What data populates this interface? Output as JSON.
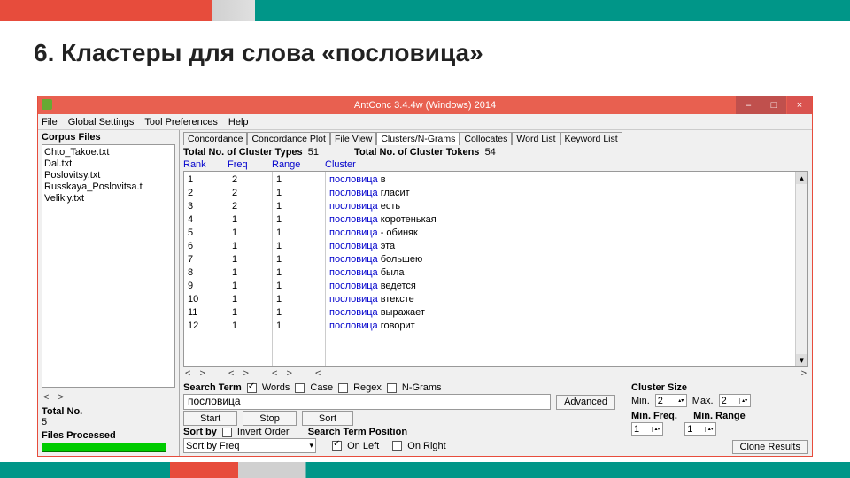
{
  "slide": {
    "title": "6. Кластеры для слова «пословица»"
  },
  "window": {
    "title": "AntConc 3.4.4w (Windows) 2014"
  },
  "winbtns": {
    "min": "–",
    "max": "□",
    "close": "×"
  },
  "menu": {
    "file": "File",
    "global": "Global Settings",
    "tool": "Tool Preferences",
    "help": "Help"
  },
  "left": {
    "corpus_label": "Corpus Files",
    "files": [
      "Chto_Takoe.txt",
      "Dal.txt",
      "Poslovitsy.txt",
      "Russkaya_Poslovitsa.t",
      "Velikiy.txt"
    ],
    "totalno_label": "Total No.",
    "totalno_value": "5",
    "filesproc_label": "Files Processed"
  },
  "tabs": [
    "Concordance",
    "Concordance Plot",
    "File View",
    "Clusters/N-Grams",
    "Collocates",
    "Word List",
    "Keyword List"
  ],
  "totals": {
    "types_label": "Total No. of Cluster Types",
    "types_value": "51",
    "tokens_label": "Total No. of Cluster Tokens",
    "tokens_value": "54"
  },
  "colheads": {
    "rank": "Rank",
    "freq": "Freq",
    "range": "Range",
    "cluster": "Cluster"
  },
  "rows": [
    {
      "rank": "1",
      "freq": "2",
      "range": "1",
      "kw": "пословица",
      "rest": " в"
    },
    {
      "rank": "2",
      "freq": "2",
      "range": "1",
      "kw": "пословица",
      "rest": " гласит"
    },
    {
      "rank": "3",
      "freq": "2",
      "range": "1",
      "kw": "пословица",
      "rest": " есть"
    },
    {
      "rank": "4",
      "freq": "1",
      "range": "1",
      "kw": "пословица",
      "rest": "   коротенькая"
    },
    {
      "rank": "5",
      "freq": "1",
      "range": "1",
      "kw": "пословица",
      "rest": " - обиняк"
    },
    {
      "rank": "6",
      "freq": "1",
      "range": "1",
      "kw": "пословица",
      "rest": "   эта"
    },
    {
      "rank": "7",
      "freq": "1",
      "range": "1",
      "kw": "пословица",
      "rest": " большею"
    },
    {
      "rank": "8",
      "freq": "1",
      "range": "1",
      "kw": "пословица",
      "rest": " была"
    },
    {
      "rank": "9",
      "freq": "1",
      "range": "1",
      "kw": "пословица",
      "rest": " ведется"
    },
    {
      "rank": "10",
      "freq": "1",
      "range": "1",
      "kw": "пословица",
      "rest": " втексте"
    },
    {
      "rank": "11",
      "freq": "1",
      "range": "1",
      "kw": "пословица",
      "rest": " выражает"
    },
    {
      "rank": "12",
      "freq": "1",
      "range": "1",
      "kw": "пословица",
      "rest": " говорит"
    }
  ],
  "search": {
    "label": "Search Term",
    "words": "Words",
    "case": "Case",
    "regex": "Regex",
    "ngrams": "N-Grams",
    "value": "пословица",
    "advanced": "Advanced",
    "start": "Start",
    "stop": "Stop",
    "sort": "Sort",
    "sortby": "Sort by",
    "invert": "Invert Order",
    "sortval": "Sort by Freq",
    "pos_label": "Search Term Position",
    "onleft": "On Left",
    "onright": "On Right"
  },
  "cluster": {
    "size_label": "Cluster Size",
    "min_label": "Min.",
    "max_label": "Max.",
    "min": "2",
    "max": "2",
    "minfreq_label": "Min. Freq.",
    "minrange_label": "Min. Range",
    "minfreq": "1",
    "minrange": "1",
    "clone": "Clone Results"
  }
}
